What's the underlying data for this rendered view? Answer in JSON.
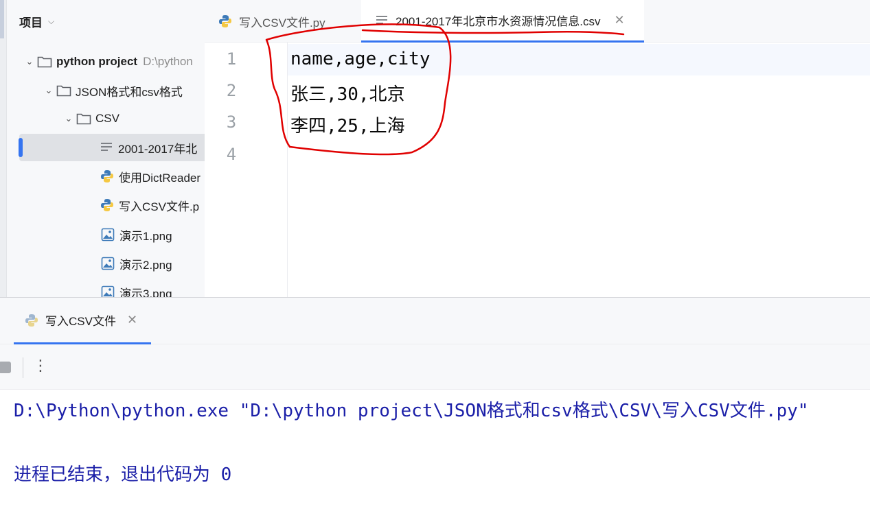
{
  "sidebar": {
    "title": "项目",
    "tree": {
      "root_name": "python project",
      "root_path": "D:\\python",
      "folder1": "JSON格式和csv格式",
      "folder2": "CSV",
      "files": [
        {
          "name": "2001-2017年北",
          "type": "text"
        },
        {
          "name": "使用DictReader",
          "type": "python"
        },
        {
          "name": "写入CSV文件.p",
          "type": "python"
        },
        {
          "name": "演示1.png",
          "type": "image"
        },
        {
          "name": "演示2.png",
          "type": "image"
        },
        {
          "name": "演示3.png",
          "type": "image"
        }
      ]
    }
  },
  "tabs": [
    {
      "label": "写入CSV文件.py",
      "icon": "python-icon",
      "active": false
    },
    {
      "label": "2001-2017年北京市水资源情况信息.csv",
      "icon": "text-file-icon",
      "active": true,
      "close": "✕"
    }
  ],
  "editor": {
    "line_numbers": [
      "1",
      "2",
      "3",
      "4"
    ],
    "lines": [
      "name,age,city",
      "张三,30,北京",
      "李四,25,上海",
      ""
    ],
    "annotation_color": "#e00000"
  },
  "run": {
    "tab_label": "写入CSV文件",
    "tab_close": "✕",
    "more": "⋮",
    "console": [
      "D:\\Python\\python.exe \"D:\\python project\\JSON格式和csv格式\\CSV\\写入CSV文件.py\"",
      "",
      "进程已结束，退出代码为 0"
    ]
  },
  "colors": {
    "accent": "#3574f0",
    "console_text": "#1b1fa8",
    "selection": "#dfe1e5"
  }
}
